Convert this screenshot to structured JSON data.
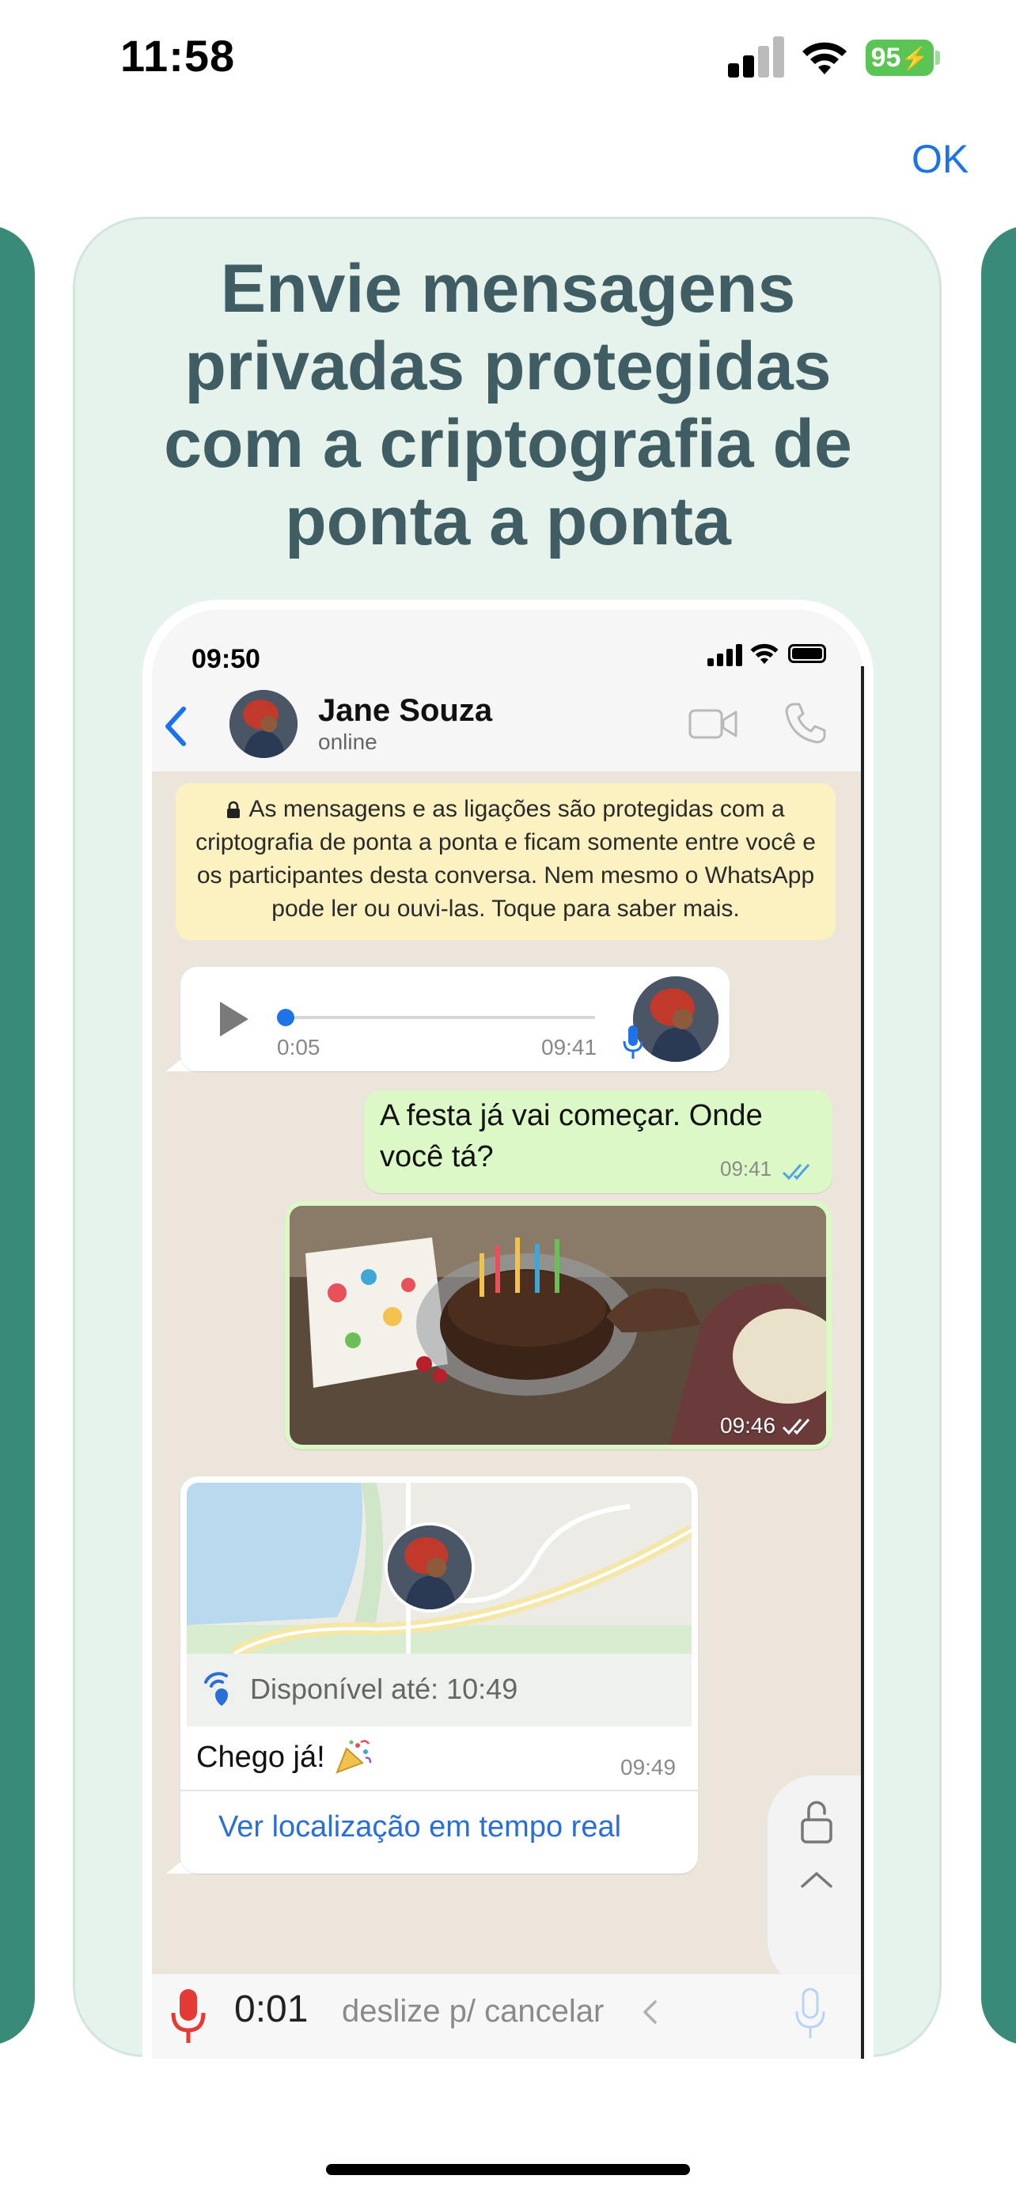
{
  "status_bar": {
    "time": "11:58",
    "battery": "95"
  },
  "header": {
    "ok_label": "OK"
  },
  "card": {
    "headline": "Envie mensagens privadas protegidas com a criptografia de ponta a ponta"
  },
  "phone": {
    "status_time": "09:50",
    "contact": {
      "name": "Jane Souza",
      "status": "online"
    },
    "encryption_notice": "As mensagens e as ligações são protegidas com a criptografia de ponta a ponta e ficam somente entre você e os participantes desta conversa. Nem mesmo o WhatsApp pode ler ou ouvi-las. Toque para saber mais.",
    "voice_message": {
      "elapsed": "0:05",
      "time": "09:41",
      "progress": 0.0
    },
    "outgoing_message": {
      "text": "A festa já vai começar. Onde você tá?",
      "time": "09:41"
    },
    "photo_message": {
      "time": "09:46"
    },
    "location_message": {
      "live_text": "Disponível até: 10:49",
      "text": "Chego já!",
      "time": "09:49",
      "link": "Ver localização em tempo real"
    },
    "recording": {
      "time": "0:01",
      "hint": "deslize p/ cancelar"
    }
  },
  "colors": {
    "accent_blue": "#1a73e8",
    "card_bg": "#e6f2ec",
    "headline": "#3f5d63",
    "side_card": "#3a8a7a",
    "outgoing_bubble": "#dcf8c7",
    "notice_bg": "#fcf1c0",
    "recording_red": "#e53935"
  },
  "icons": [
    "signal-icon",
    "wifi-icon",
    "battery-icon",
    "back-chevron-icon",
    "video-call-icon",
    "phone-call-icon",
    "lock-icon",
    "play-icon",
    "microphone-icon",
    "double-check-icon",
    "live-location-icon",
    "party-popper-icon",
    "unlock-icon",
    "chevron-up-icon",
    "chevron-left-icon"
  ]
}
